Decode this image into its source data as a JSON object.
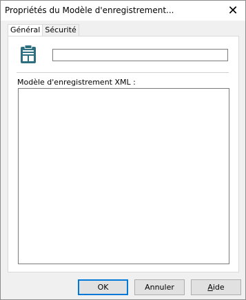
{
  "window": {
    "title": "Propriétés du Modèle d'enregistrement...",
    "close_glyph": "✕"
  },
  "tabs": [
    {
      "label": "Général",
      "active": true
    },
    {
      "label": "Sécurité",
      "active": false
    }
  ],
  "general": {
    "icon": "clipboard-icon",
    "name_value": "",
    "xml_label": "Modèle d'enregistrement XML :",
    "xml_value": ""
  },
  "buttons": {
    "ok": "OK",
    "cancel": "Annuler",
    "help_accel": "A",
    "help_rest": "ide"
  },
  "colors": {
    "accent": "#0078d7",
    "icon_teal": "#2e6f7f"
  }
}
